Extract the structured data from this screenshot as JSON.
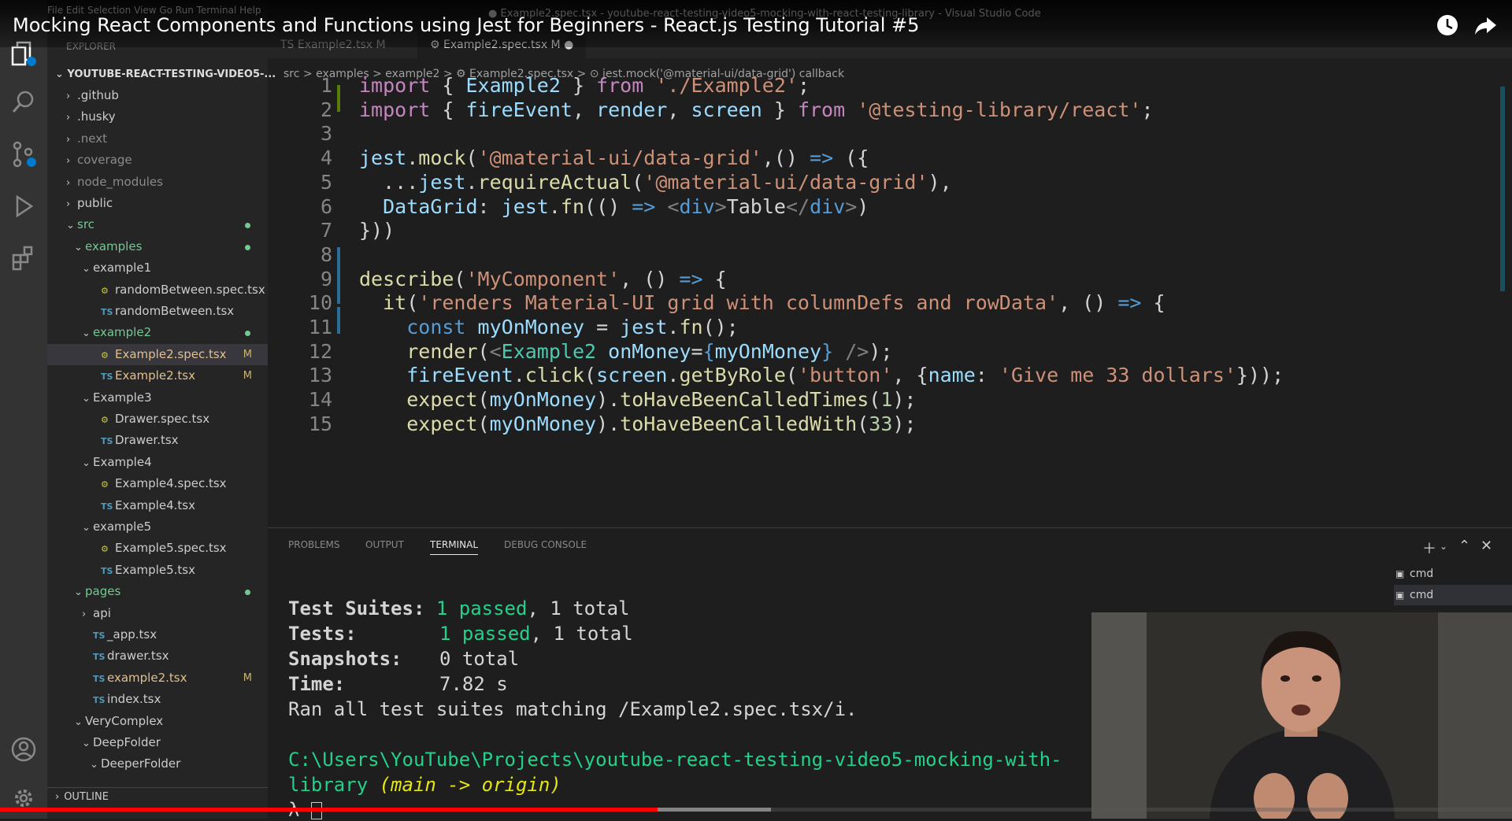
{
  "video": {
    "title": "Mocking React Components and Functions using Jest for Beginners - React.js Testing Tutorial #5",
    "progress": 0.435,
    "buffered": 0.51
  },
  "vscode": {
    "menu": "File   Edit   Selection   View   Go   Run   Terminal   Help",
    "window_title": "● Example2.spec.tsx - youtube-react-testing-video5-mocking-with-react-testing-library - Visual Studio Code"
  },
  "sidebar": {
    "title": "EXPLORER",
    "root": "YOUTUBE-REACT-TESTING-VIDEO5-...",
    "outline": "OUTLINE",
    "items": [
      {
        "label": ".github",
        "chev": "›",
        "icon": ""
      },
      {
        "label": ".husky",
        "chev": "›",
        "icon": ""
      },
      {
        "label": ".next",
        "chev": "›",
        "icon": "",
        "dim": true
      },
      {
        "label": "coverage",
        "chev": "›",
        "icon": "",
        "dim": true
      },
      {
        "label": "node_modules",
        "chev": "›",
        "icon": "",
        "dim": true
      },
      {
        "label": "public",
        "chev": "›",
        "icon": ""
      },
      {
        "label": "src",
        "chev": "⌄",
        "icon": "",
        "dot": true
      },
      {
        "label": "examples",
        "chev": "⌄",
        "icon": "",
        "dot": true
      },
      {
        "label": "example1",
        "chev": "⌄",
        "icon": ""
      },
      {
        "label": "randomBetween.spec.tsx",
        "chev": "",
        "icon": "spec"
      },
      {
        "label": "randomBetween.tsx",
        "chev": "",
        "icon": "ts"
      },
      {
        "label": "example2",
        "chev": "⌄",
        "icon": "",
        "dot": true
      },
      {
        "label": "Example2.spec.tsx",
        "chev": "",
        "icon": "spec",
        "mod": "M",
        "selected": true
      },
      {
        "label": "Example2.tsx",
        "chev": "",
        "icon": "ts",
        "mod": "M"
      },
      {
        "label": "Example3",
        "chev": "⌄",
        "icon": ""
      },
      {
        "label": "Drawer.spec.tsx",
        "chev": "",
        "icon": "spec"
      },
      {
        "label": "Drawer.tsx",
        "chev": "",
        "icon": "ts"
      },
      {
        "label": "Example4",
        "chev": "⌄",
        "icon": ""
      },
      {
        "label": "Example4.spec.tsx",
        "chev": "",
        "icon": "spec"
      },
      {
        "label": "Example4.tsx",
        "chev": "",
        "icon": "ts"
      },
      {
        "label": "example5",
        "chev": "⌄",
        "icon": ""
      },
      {
        "label": "Example5.spec.tsx",
        "chev": "",
        "icon": "spec"
      },
      {
        "label": "Example5.tsx",
        "chev": "",
        "icon": "ts"
      },
      {
        "label": "pages",
        "chev": "⌄",
        "icon": "",
        "dot": true
      },
      {
        "label": "api",
        "chev": "›",
        "icon": ""
      },
      {
        "label": "_app.tsx",
        "chev": "",
        "icon": "ts"
      },
      {
        "label": "drawer.tsx",
        "chev": "",
        "icon": "ts"
      },
      {
        "label": "example2.tsx",
        "chev": "",
        "icon": "ts",
        "mod": "M"
      },
      {
        "label": "index.tsx",
        "chev": "",
        "icon": "ts"
      },
      {
        "label": "VeryComplex",
        "chev": "⌄",
        "icon": ""
      },
      {
        "label": "DeepFolder",
        "chev": "⌄",
        "icon": ""
      },
      {
        "label": "DeeperFolder",
        "chev": "⌄",
        "icon": ""
      }
    ]
  },
  "editor": {
    "tabs": [
      {
        "label": "TS Example2.tsx  M",
        "active": false
      },
      {
        "label": "⚙ Example2.spec.tsx  M  ●",
        "active": true
      }
    ],
    "breadcrumb": "src > examples > example2 > ⚙ Example2.spec.tsx > ⊙ jest.mock('@material-ui/data-grid') callback",
    "lines": [
      {
        "n": "1",
        "tokens": [
          [
            "kw",
            "import"
          ],
          [
            "p",
            " { "
          ],
          [
            "var",
            "Example2"
          ],
          [
            "p",
            " } "
          ],
          [
            "kw",
            "from"
          ],
          [
            "p",
            " "
          ],
          [
            "str",
            "'./Example2'"
          ],
          [
            "p",
            ";"
          ]
        ]
      },
      {
        "n": "2",
        "tokens": [
          [
            "kw",
            "import"
          ],
          [
            "p",
            " { "
          ],
          [
            "var",
            "fireEvent"
          ],
          [
            "p",
            ", "
          ],
          [
            "var",
            "render"
          ],
          [
            "p",
            ", "
          ],
          [
            "var",
            "screen"
          ],
          [
            "p",
            " } "
          ],
          [
            "kw",
            "from"
          ],
          [
            "p",
            " "
          ],
          [
            "str",
            "'@testing-library/react'"
          ],
          [
            "p",
            ";"
          ]
        ]
      },
      {
        "n": "3",
        "tokens": []
      },
      {
        "n": "4",
        "tokens": [
          [
            "var",
            "jest"
          ],
          [
            "p",
            "."
          ],
          [
            "fn",
            "mock"
          ],
          [
            "p",
            "("
          ],
          [
            "str",
            "'@material-ui/data-grid'"
          ],
          [
            "p",
            ",() "
          ],
          [
            "bl",
            "=>"
          ],
          [
            "p",
            " ({"
          ]
        ]
      },
      {
        "n": "5",
        "tokens": [
          [
            "p",
            "  ..."
          ],
          [
            "var",
            "jest"
          ],
          [
            "p",
            "."
          ],
          [
            "fn",
            "requireActual"
          ],
          [
            "p",
            "("
          ],
          [
            "str",
            "'@material-ui/data-grid'"
          ],
          [
            "p",
            "),"
          ]
        ]
      },
      {
        "n": "6",
        "tokens": [
          [
            "p",
            "  "
          ],
          [
            "var",
            "DataGrid"
          ],
          [
            "p",
            ": "
          ],
          [
            "var",
            "jest"
          ],
          [
            "p",
            "."
          ],
          [
            "fn",
            "fn"
          ],
          [
            "p",
            "(() "
          ],
          [
            "bl",
            "=>"
          ],
          [
            "p",
            " "
          ],
          [
            "tag",
            "<"
          ],
          [
            "bl",
            "div"
          ],
          [
            "tag",
            ">"
          ],
          [
            "p",
            "Table"
          ],
          [
            "tag",
            "</"
          ],
          [
            "bl",
            "div"
          ],
          [
            "tag",
            ">"
          ],
          [
            "p",
            ")"
          ]
        ]
      },
      {
        "n": "7",
        "tokens": [
          [
            "p",
            "}))"
          ]
        ]
      },
      {
        "n": "8",
        "tokens": []
      },
      {
        "n": "9",
        "tokens": [
          [
            "fn",
            "describe"
          ],
          [
            "p",
            "("
          ],
          [
            "str",
            "'MyComponent'"
          ],
          [
            "p",
            ", () "
          ],
          [
            "bl",
            "=>"
          ],
          [
            "p",
            " {"
          ]
        ]
      },
      {
        "n": "10",
        "tokens": [
          [
            "p",
            "  "
          ],
          [
            "fn",
            "it"
          ],
          [
            "p",
            "("
          ],
          [
            "str",
            "'renders Material-UI grid with columnDefs and rowData'"
          ],
          [
            "p",
            ", () "
          ],
          [
            "bl",
            "=>"
          ],
          [
            "p",
            " {"
          ]
        ]
      },
      {
        "n": "11",
        "tokens": [
          [
            "p",
            "    "
          ],
          [
            "bl",
            "const"
          ],
          [
            "p",
            " "
          ],
          [
            "var",
            "myOnMoney"
          ],
          [
            "p",
            " = "
          ],
          [
            "var",
            "jest"
          ],
          [
            "p",
            "."
          ],
          [
            "fn",
            "fn"
          ],
          [
            "p",
            "();"
          ]
        ]
      },
      {
        "n": "12",
        "tokens": [
          [
            "p",
            "    "
          ],
          [
            "fn",
            "render"
          ],
          [
            "p",
            "("
          ],
          [
            "tag",
            "<"
          ],
          [
            "cls",
            "Example2"
          ],
          [
            "p",
            " "
          ],
          [
            "var",
            "onMoney"
          ],
          [
            "p",
            "="
          ],
          [
            "bl",
            "{"
          ],
          [
            "var",
            "myOnMoney"
          ],
          [
            "bl",
            "}"
          ],
          [
            "p",
            " "
          ],
          [
            "tag",
            "/>"
          ],
          [
            "p",
            ");"
          ]
        ]
      },
      {
        "n": "13",
        "tokens": [
          [
            "p",
            "    "
          ],
          [
            "var",
            "fireEvent"
          ],
          [
            "p",
            "."
          ],
          [
            "fn",
            "click"
          ],
          [
            "p",
            "("
          ],
          [
            "var",
            "screen"
          ],
          [
            "p",
            "."
          ],
          [
            "fn",
            "getByRole"
          ],
          [
            "p",
            "("
          ],
          [
            "str",
            "'button'"
          ],
          [
            "p",
            ", {"
          ],
          [
            "var",
            "name"
          ],
          [
            "p",
            ": "
          ],
          [
            "str",
            "'Give me 33 dollars'"
          ],
          [
            "p",
            "}));"
          ]
        ]
      },
      {
        "n": "14",
        "tokens": [
          [
            "p",
            "    "
          ],
          [
            "fn",
            "expect"
          ],
          [
            "p",
            "("
          ],
          [
            "var",
            "myOnMoney"
          ],
          [
            "p",
            ")."
          ],
          [
            "fn",
            "toHaveBeenCalledTimes"
          ],
          [
            "p",
            "("
          ],
          [
            "num",
            "1"
          ],
          [
            "p",
            ");"
          ]
        ]
      },
      {
        "n": "15",
        "tokens": [
          [
            "p",
            "    "
          ],
          [
            "fn",
            "expect"
          ],
          [
            "p",
            "("
          ],
          [
            "var",
            "myOnMoney"
          ],
          [
            "p",
            ")."
          ],
          [
            "fn",
            "toHaveBeenCalledWith"
          ],
          [
            "p",
            "("
          ],
          [
            "num",
            "33"
          ],
          [
            "p",
            ");"
          ]
        ]
      }
    ]
  },
  "panel": {
    "tabs": [
      "PROBLEMS",
      "OUTPUT",
      "TERMINAL",
      "DEBUG CONSOLE"
    ],
    "active_tab": "TERMINAL",
    "terminals": [
      "cmd",
      "cmd"
    ],
    "output": {
      "suites_label": "Test Suites:",
      "suites_passed": "1 passed",
      "suites_total": ", 1 total",
      "tests_label": "Tests:",
      "tests_passed": "1 passed",
      "tests_total": ", 1 total",
      "snapshots_label": "Snapshots:",
      "snapshots_value": "0 total",
      "time_label": "Time:",
      "time_value": "7.82 s",
      "ran": "Ran all test suites matching /Example2.spec.tsx/i.",
      "path1": "C:\\Users\\YouTube\\Projects\\youtube-react-testing-video5-mocking-with-",
      "path2": "library ",
      "branch": "(main -> origin)",
      "prompt": "λ"
    }
  },
  "colors": {
    "progress": "#ff0000",
    "accent": "#007acc"
  }
}
